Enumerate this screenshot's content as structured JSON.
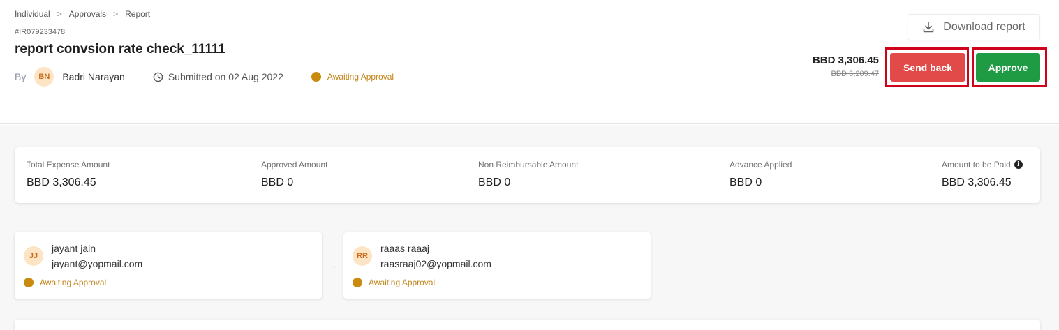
{
  "breadcrumb": {
    "items": [
      "Individual",
      "Approvals",
      "Report"
    ],
    "separator": ">"
  },
  "report": {
    "id": "#IR079233478",
    "title": "report convsion rate check_11111",
    "by_label": "By",
    "submitter_initials": "BN",
    "submitter_name": "Badri Narayan",
    "submitted_text": "Submitted on 02 Aug 2022",
    "status": "Awaiting Approval"
  },
  "actions": {
    "download_label": "Download report",
    "send_back_label": "Send back",
    "approve_label": "Approve"
  },
  "amounts": {
    "main": "BBD 3,306.45",
    "original": "BBD 6,209.47"
  },
  "summary": [
    {
      "label": "Total Expense Amount",
      "value": "BBD 3,306.45"
    },
    {
      "label": "Approved Amount",
      "value": "BBD 0"
    },
    {
      "label": "Non Reimbursable Amount",
      "value": "BBD 0"
    },
    {
      "label": "Advance Applied",
      "value": "BBD 0"
    },
    {
      "label": "Amount to be Paid",
      "value": "BBD 3,306.45"
    }
  ],
  "approvers": [
    {
      "initials": "JJ",
      "name": "jayant jain",
      "email": "jayant@yopmail.com",
      "status": "Awaiting Approval"
    },
    {
      "initials": "RR",
      "name": "raaas raaaj",
      "email": "raasraaj02@yopmail.com",
      "status": "Awaiting Approval"
    }
  ],
  "colors": {
    "send_back": "#e24a4a",
    "approve": "#1e9b43",
    "awaiting": "#c98b0f",
    "highlight": "#d0021b"
  },
  "icons": {
    "download": "download-icon",
    "clock": "clock-icon",
    "info": "info-icon",
    "arrow": "arrow-right-icon"
  }
}
